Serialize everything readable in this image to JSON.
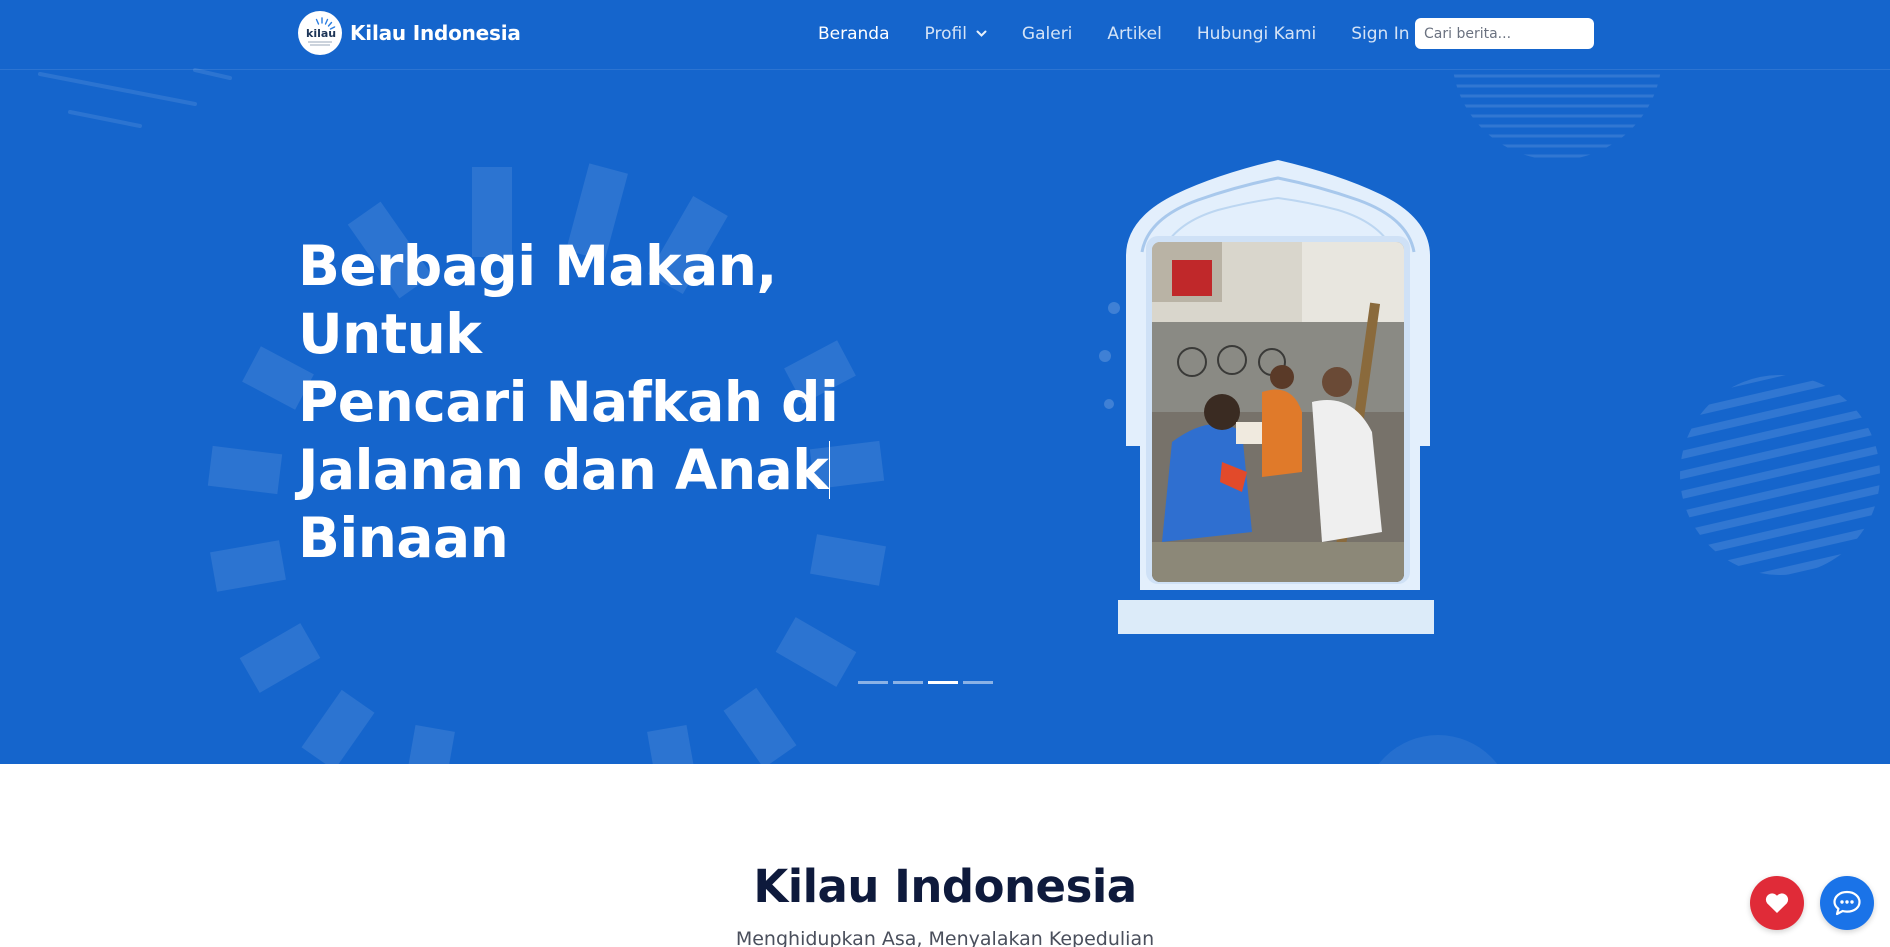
{
  "brand": {
    "name": "Kilau Indonesia",
    "logo_text": "kilau"
  },
  "nav": {
    "items": [
      {
        "label": "Beranda",
        "active": true
      },
      {
        "label": "Profil",
        "active": false,
        "has_dropdown": true
      },
      {
        "label": "Galeri",
        "active": false
      },
      {
        "label": "Artikel",
        "active": false
      },
      {
        "label": "Hubungi Kami",
        "active": false
      },
      {
        "label": "Sign In",
        "active": false
      }
    ],
    "search_placeholder": "Cari berita..."
  },
  "hero": {
    "title_lines": [
      "Berbagi Makan, Untuk",
      "Pencari Nafkah di",
      "Jalanan dan Anak",
      "Binaan"
    ],
    "slides_total": 4,
    "active_slide": 3
  },
  "about": {
    "title": "Kilau Indonesia",
    "subtitle": "Menghidupkan Asa, Menyalakan Kepedulian"
  },
  "floating_buttons": [
    {
      "name": "donate",
      "icon": "heart-icon"
    },
    {
      "name": "chat",
      "icon": "chat-bubble-icon"
    }
  ],
  "colors": {
    "hero_bg": "#1565cc",
    "donate": "#e02b38",
    "chat": "#1a73e8",
    "heading_dark": "#0e1a3c"
  }
}
